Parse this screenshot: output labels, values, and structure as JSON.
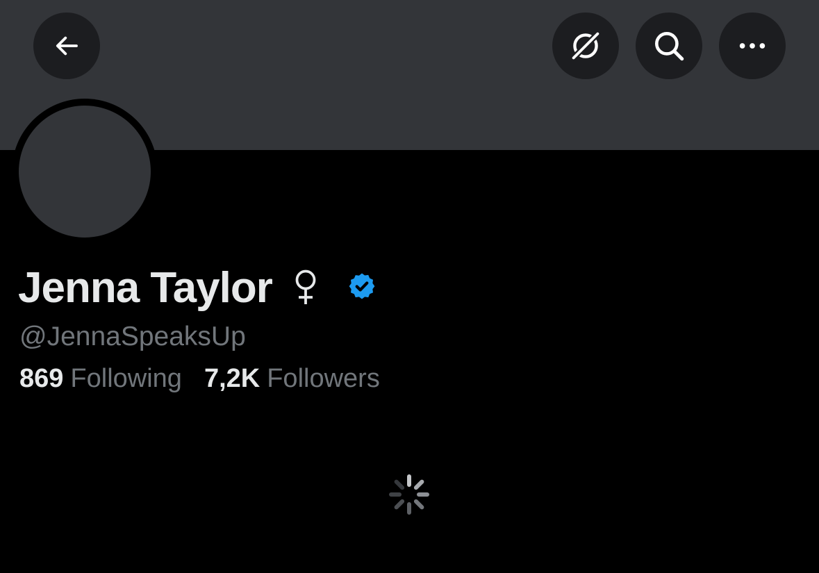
{
  "header": {
    "back_icon": "arrow-left-icon",
    "grok_icon": "grok-icon",
    "search_icon": "search-icon",
    "more_icon": "more-horizontal-icon",
    "banner_color": "#333539",
    "button_color": "#1c1d20"
  },
  "profile": {
    "display_name": "Jenna Taylor",
    "gender_icon": "female-symbol-icon",
    "verified_icon": "verified-badge-icon",
    "verified_color": "#1d9bf0",
    "handle": "@JennaSpeaksUp",
    "following_count": "869",
    "following_label": "Following",
    "followers_count": "7,2K",
    "followers_label": "Followers"
  },
  "content": {
    "loading_icon": "loading-spinner-icon"
  }
}
